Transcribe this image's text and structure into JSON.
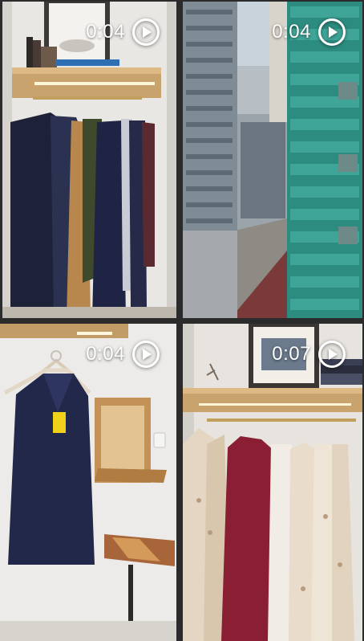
{
  "gallery": {
    "items": [
      {
        "duration": "0:04",
        "icon": "play-circle-icon"
      },
      {
        "duration": "0:04",
        "icon": "play-circle-icon"
      },
      {
        "duration": "0:04",
        "icon": "play-circle-icon"
      },
      {
        "duration": "0:07",
        "icon": "play-circle-icon"
      }
    ]
  }
}
